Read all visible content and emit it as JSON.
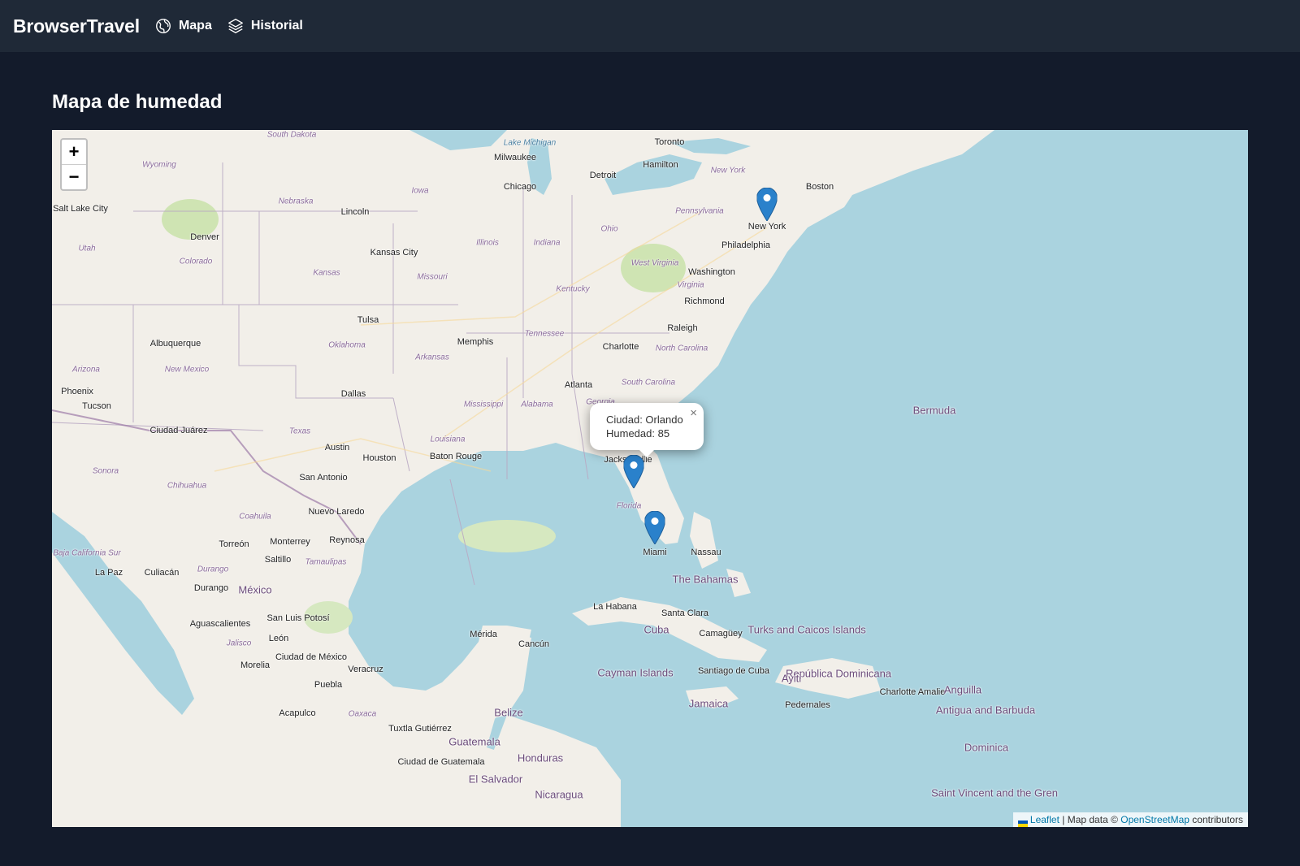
{
  "nav": {
    "brand": "BrowserTravel",
    "items": [
      {
        "label": "Mapa",
        "icon": "globe-icon"
      },
      {
        "label": "Historial",
        "icon": "layers-icon"
      }
    ]
  },
  "page": {
    "title": "Mapa de humedad"
  },
  "map": {
    "zoom_in": "+",
    "zoom_out": "−",
    "markers": [
      {
        "city": "New York"
      },
      {
        "city": "Orlando"
      },
      {
        "city": "Miami"
      }
    ],
    "popup": {
      "line1": "Ciudad: Orlando",
      "line2": "Humedad: 85",
      "close": "×"
    },
    "attribution": {
      "leaflet": "Leaflet",
      "separator": " | Map data © ",
      "osm": "OpenStreetMap",
      "contributors": " contributors"
    },
    "labels": {
      "cities": [
        "Toronto",
        "Milwaukee",
        "Hamilton",
        "Detroit",
        "Chicago",
        "Boston",
        "New York",
        "Salt Lake City",
        "Lincoln",
        "Denver",
        "Philadelphia",
        "Kansas City",
        "Washington",
        "Richmond",
        "Tulsa",
        "Raleigh",
        "Albuquerque",
        "Memphis",
        "Charlotte",
        "Atlanta",
        "Dallas",
        "Phoenix",
        "Tucson",
        "Ciudad Juárez",
        "Austin",
        "Houston",
        "Baton Rouge",
        "Jacksonville",
        "San Antonio",
        "Nuevo Laredo",
        "Torreón",
        "Monterrey",
        "Reynosa",
        "Saltillo",
        "La Paz",
        "Culiacán",
        "Durango",
        "Miami",
        "Nassau",
        "San Luis Potosí",
        "Aguascalientes",
        "León",
        "La Habana",
        "Santa Clara",
        "Camagüey",
        "Mérida",
        "Cancún",
        "Ciudad de México",
        "Morelia",
        "Veracruz",
        "Puebla",
        "Santiago de Cuba",
        "Acapulco",
        "Tuxtla Gutiérrez",
        "Ciudad de Guatemala",
        "Pedernales",
        "Charlotte Amalie"
      ],
      "states": [
        "South Dakota",
        "Wyoming",
        "Nebraska",
        "Iowa",
        "Utah",
        "Colorado",
        "Kansas",
        "Missouri",
        "Illinois",
        "Indiana",
        "Ohio",
        "Pennsylvania",
        "New York",
        "West Virginia",
        "Virginia",
        "Kentucky",
        "Tennessee",
        "Oklahoma",
        "Arkansas",
        "North Carolina",
        "South Carolina",
        "Arizona",
        "New Mexico",
        "Mississippi",
        "Alabama",
        "Georgia",
        "Texas",
        "Louisiana",
        "Sonora",
        "Chihuahua",
        "Coahuila",
        "Florida",
        "Baja California Sur",
        "Durango",
        "Tamaulipas",
        "Jalisco",
        "Oaxaca",
        "Lake Michigan"
      ],
      "countries": [
        "México",
        "Bermuda",
        "The Bahamas",
        "Cuba",
        "Turks and Caicos Islands",
        "Cayman Islands",
        "Jamaica",
        "República Dominicana",
        "Ayiti",
        "Belize",
        "Guatemala",
        "Honduras",
        "El Salvador",
        "Nicaragua",
        "Anguilla",
        "Antigua and Barbuda",
        "Dominica",
        "Saint Vincent and the Gren"
      ]
    }
  }
}
